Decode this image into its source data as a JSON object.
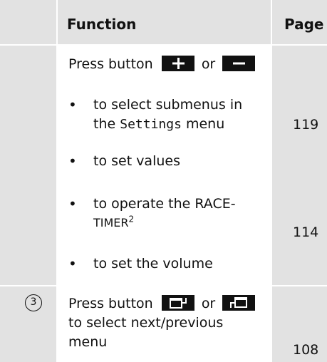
{
  "header": {
    "function_label": "Function",
    "page_label": "Page"
  },
  "row1": {
    "intro_prefix": "Press button",
    "intro_or": "or",
    "buttons": [
      "plus-button-icon",
      "minus-button-icon"
    ],
    "bullets": [
      {
        "line1": "to select submenus in",
        "line2_prefix": "the",
        "line2_code": "Settings",
        "line2_suffix": "menu",
        "page": "119"
      },
      {
        "line1": "to set values"
      },
      {
        "line1": "to operate the RACE-",
        "line2": "TIMER",
        "footnote": "2",
        "page": "114"
      },
      {
        "line1": "to set the volume"
      }
    ]
  },
  "row2": {
    "marker": "3",
    "intro_prefix": "Press button",
    "intro_or": "or",
    "buttons": [
      "next-menu-button-icon",
      "previous-menu-button-icon"
    ],
    "line2": "to select next/previous",
    "line3": "menu",
    "page": "108"
  },
  "colors": {
    "shade": "#e2e2e2",
    "ink": "#111111",
    "background": "#ffffff"
  }
}
